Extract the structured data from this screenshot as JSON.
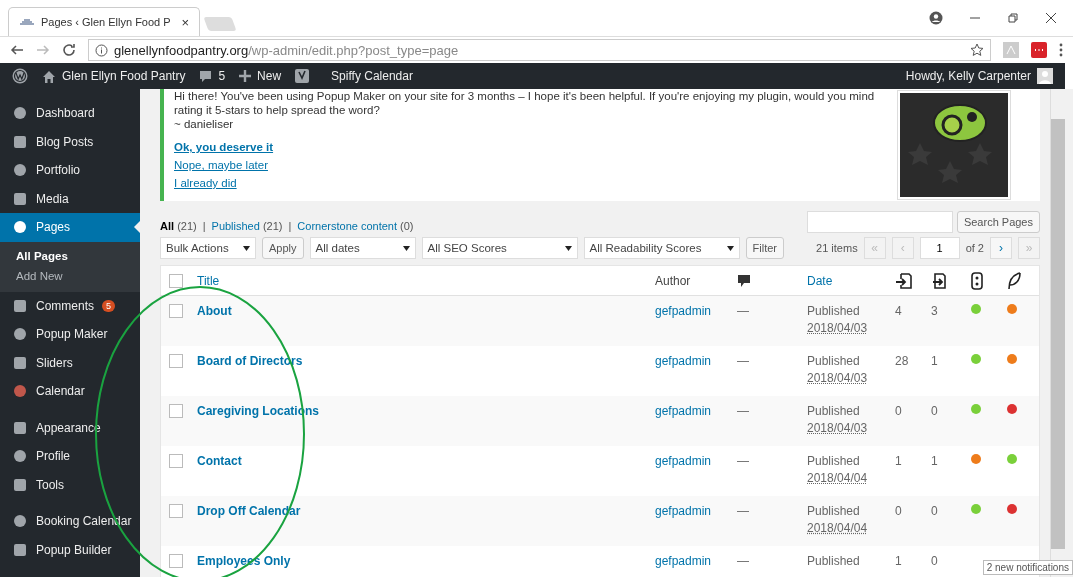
{
  "browser": {
    "tab_title": "Pages ‹ Glen Ellyn Food P",
    "close": "×",
    "address_domain": "glenellynfoodpantry.org",
    "address_path": "/wp-admin/edit.php?post_type=page"
  },
  "admin_bar": {
    "site_name": "Glen Ellyn Food Pantry",
    "comments_count": "5",
    "new_label": "New",
    "calendar_label": "Spiffy Calendar",
    "greeting": "Howdy, Kelly Carpenter"
  },
  "sidebar": {
    "items": [
      {
        "label": "Dashboard",
        "selected": false
      },
      {
        "label": "Blog Posts",
        "selected": false
      },
      {
        "label": "Portfolio",
        "selected": false
      },
      {
        "label": "Media",
        "selected": false
      },
      {
        "label": "Pages",
        "selected": true,
        "children": [
          {
            "label": "All Pages",
            "selected": true
          },
          {
            "label": "Add New",
            "selected": false
          }
        ]
      },
      {
        "label": "Comments",
        "selected": false,
        "badge": "5"
      },
      {
        "label": "Popup Maker",
        "selected": false
      },
      {
        "label": "Sliders",
        "selected": false
      },
      {
        "label": "Calendar",
        "selected": false
      },
      {
        "label": "Appearance",
        "selected": false
      },
      {
        "label": "Profile",
        "selected": false
      },
      {
        "label": "Tools",
        "selected": false
      },
      {
        "label": "Booking Calendar",
        "selected": false
      },
      {
        "label": "Popup Builder",
        "selected": false
      }
    ]
  },
  "notice": {
    "lines": [
      "Hi there! You've been using Popup Maker on your site for 3 months – I hope it's been helpful. If you're enjoying my plugin, would you mind",
      "rating it 5-stars to help spread the word?",
      "~ danieliser"
    ],
    "links": [
      {
        "label": "Ok, you deserve it",
        "bold": true
      },
      {
        "label": "Nope, maybe later",
        "bold": false
      },
      {
        "label": "I already did",
        "bold": false
      }
    ]
  },
  "views": [
    {
      "label": "All",
      "count": "(21)",
      "selected": true
    },
    {
      "label": "Published",
      "count": "(21)",
      "selected": false
    },
    {
      "label": "Cornerstone content",
      "count": "(0)",
      "selected": false
    }
  ],
  "view_separator": "|",
  "search_button": "Search Pages",
  "filters": {
    "bulk_actions": "Bulk Actions",
    "apply": "Apply",
    "dates": "All dates",
    "seo": "All SEO Scores",
    "readability": "All Readability Scores",
    "filter": "Filter"
  },
  "pagination": {
    "items": "21 items",
    "buttons": [
      {
        "label": "«",
        "disabled": true
      },
      {
        "label": "‹",
        "disabled": true
      }
    ],
    "page": "1",
    "of": "of 2",
    "next_buttons": [
      {
        "label": "›",
        "disabled": false
      },
      {
        "label": "»",
        "disabled": true
      }
    ]
  },
  "table": {
    "select_all_checked": false,
    "columns": {
      "title": "Title",
      "author": "Author",
      "date": "Date"
    },
    "rows": [
      {
        "title": "About",
        "author": "gefpadmin",
        "comments": "—",
        "status": "Published",
        "date": "2018/04/03",
        "links_in": "4",
        "links_out": "3",
        "checked": false,
        "seo": {
          "color": "#7ad03a"
        },
        "readability": {
          "color": "#ee7c1b"
        }
      },
      {
        "title": "Board of Directors",
        "author": "gefpadmin",
        "comments": "—",
        "status": "Published",
        "date": "2018/04/03",
        "links_in": "28",
        "links_out": "1",
        "checked": false,
        "seo": {
          "color": "#7ad03a"
        },
        "readability": {
          "color": "#ee7c1b"
        }
      },
      {
        "title": "Caregiving Locations",
        "author": "gefpadmin",
        "comments": "—",
        "status": "Published",
        "date": "2018/04/03",
        "links_in": "0",
        "links_out": "0",
        "checked": false,
        "seo": {
          "color": "#7ad03a"
        },
        "readability": {
          "color": "#dc3232"
        }
      },
      {
        "title": "Contact",
        "author": "gefpadmin",
        "comments": "—",
        "status": "Published",
        "date": "2018/04/04",
        "links_in": "1",
        "links_out": "1",
        "checked": false,
        "seo": {
          "color": "#ee7c1b"
        },
        "readability": {
          "color": "#7ad03a"
        }
      },
      {
        "title": "Drop Off Calendar",
        "author": "gefpadmin",
        "comments": "—",
        "status": "Published",
        "date": "2018/04/04",
        "links_in": "0",
        "links_out": "0",
        "checked": false,
        "seo": {
          "color": "#7ad03a"
        },
        "readability": {
          "color": "#dc3232"
        }
      },
      {
        "title": "Employees Only",
        "author": "gefpadmin",
        "comments": "—",
        "status": "Published",
        "links_in": "1",
        "links_out": "0",
        "checked": false
      }
    ]
  },
  "notification": "2 new notifications"
}
